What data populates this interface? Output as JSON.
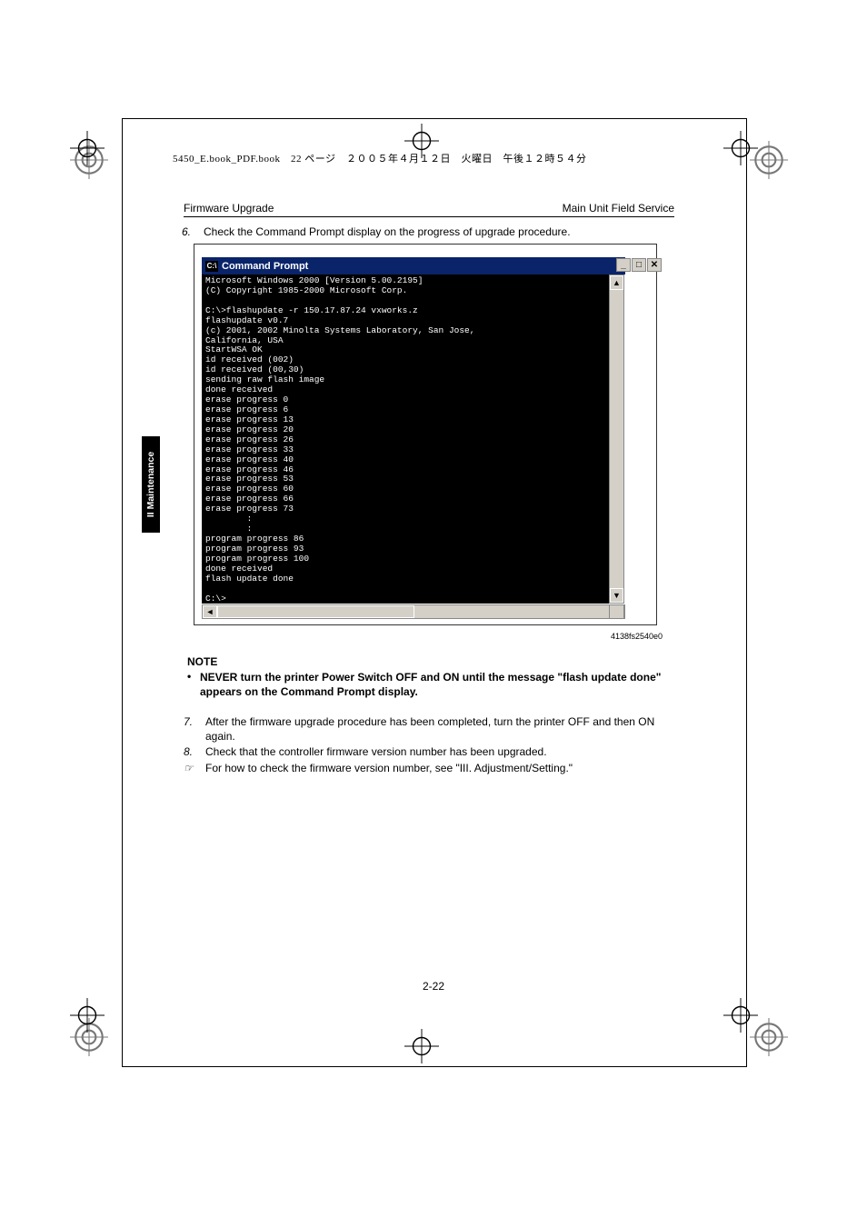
{
  "book_header": "5450_E.book_PDF.book　22 ページ　２００５年４月１２日　火曜日　午後１２時５４分",
  "header": {
    "left": "Firmware Upgrade",
    "right": "Main Unit Field Service"
  },
  "side_tab": "II Maintenance",
  "step6": {
    "num": "6.",
    "text": "Check the Command Prompt display on the progress of upgrade procedure."
  },
  "cmd": {
    "title": "Command Prompt",
    "min": "_",
    "max": "□",
    "close": "✕",
    "body": "Microsoft Windows 2000 [Version 5.00.2195]\n(C) Copyright 1985-2000 Microsoft Corp.\n\nC:\\>flashupdate -r 150.17.87.24 vxworks.z\nflashupdate v0.7\n(c) 2001, 2002 Minolta Systems Laboratory, San Jose,\nCalifornia, USA\nStartWSA OK\nid received (002)\nid received (00,30)\nsending raw flash image\ndone received\nerase progress 0\nerase progress 6\nerase progress 13\nerase progress 20\nerase progress 26\nerase progress 33\nerase progress 40\nerase progress 46\nerase progress 53\nerase progress 60\nerase progress 66\nerase progress 73\n        :\n        :\nprogram progress 86\nprogram progress 93\nprogram progress 100\ndone received\nflash update done\n\nC:\\>"
  },
  "fig_label": "4138fs2540e0",
  "note": {
    "title": "NOTE",
    "bullet": "•",
    "text": "NEVER turn the printer Power Switch OFF and ON until the message \"flash update done\" appears on the Command Prompt display."
  },
  "steps": [
    {
      "num": "7.",
      "text": "After the firmware upgrade procedure has been completed, turn the printer OFF and then ON again."
    },
    {
      "num": "8.",
      "text": "Check that the controller firmware version number has been upgraded."
    },
    {
      "num": "☞",
      "text": "For how to check the firmware version number, see \"III. Adjustment/Setting.\""
    }
  ],
  "page_num": "2-22"
}
